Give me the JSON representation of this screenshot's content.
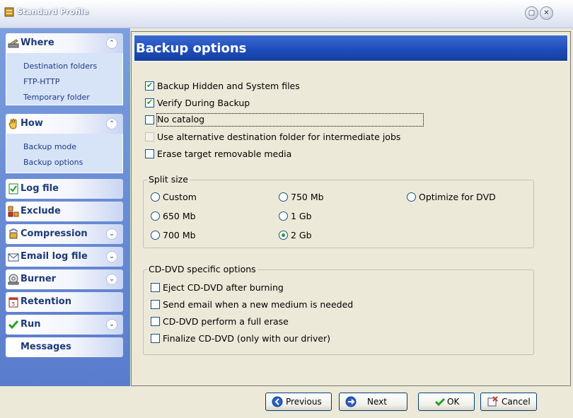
{
  "window": {
    "title": "Standard Profile"
  },
  "sidebar": {
    "where": {
      "label": "Where",
      "items": [
        "Destination folders",
        "FTP-HTTP",
        "Temporary folder"
      ]
    },
    "how": {
      "label": "How",
      "items": [
        "Backup mode",
        "Backup options"
      ]
    },
    "log_file": "Log file",
    "exclude": "Exclude",
    "compression": "Compression",
    "email_log_file": "Email log file",
    "burner": "Burner",
    "retention": "Retention",
    "run": "Run",
    "messages": "Messages"
  },
  "content": {
    "title": "Backup options",
    "options": [
      {
        "label": "Backup Hidden and System files",
        "checked": true
      },
      {
        "label": "Verify During Backup",
        "checked": true
      },
      {
        "label": "No catalog",
        "checked": false
      },
      {
        "label": "Use alternative destination folder for intermediate jobs",
        "checked": false,
        "disabled": true
      },
      {
        "label": "Erase target removable media",
        "checked": false
      }
    ],
    "split_size": {
      "legend": "Split size",
      "options": [
        "Custom",
        "650 Mb",
        "700 Mb",
        "750 Mb",
        "1 Gb",
        "2 Gb",
        "Optimize for DVD"
      ],
      "selected": "2 Gb"
    },
    "cd_dvd": {
      "legend": "CD-DVD specific options",
      "options": [
        "Eject CD-DVD after burning",
        "Send email when a new medium is needed",
        "CD-DVD perform a full erase",
        "Finalize CD-DVD (only with our driver)"
      ]
    }
  },
  "buttons": {
    "previous": "Previous",
    "next": "Next",
    "ok": "OK",
    "cancel": "Cancel"
  },
  "icons": {
    "app": "app-icon",
    "minimize": "minimize-icon",
    "close": "close-icon",
    "collapse": "chevron-up-icon",
    "expand": "chevron-down-icon"
  }
}
